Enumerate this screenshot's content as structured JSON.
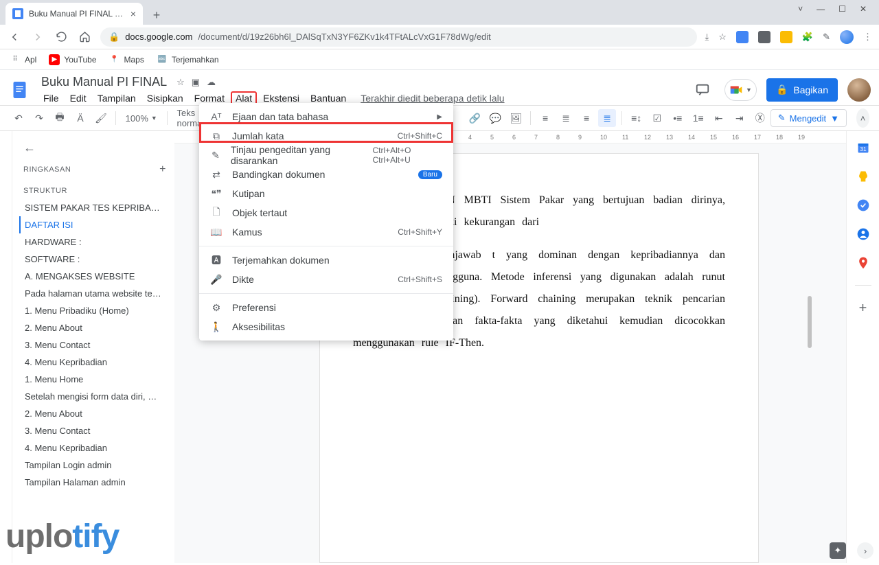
{
  "browser": {
    "tab_title": "Buku Manual PI FINAL - Google",
    "url_host": "docs.google.com",
    "url_path": "/document/d/19z26bh6l_DAlSqTxN3YF6ZKv1k4TFtALcVxG1F78dWg/edit",
    "bookmarks": {
      "apps": "Apl",
      "youtube": "YouTube",
      "maps": "Maps",
      "translate": "Terjemahkan"
    }
  },
  "doc": {
    "title": "Buku Manual PI FINAL",
    "menus": [
      "File",
      "Edit",
      "Tampilan",
      "Sisipkan",
      "Format",
      "Alat",
      "Ekstensi",
      "Bantuan"
    ],
    "history": "Terakhir diedit beberapa detik lalu",
    "share": "Bagikan"
  },
  "toolbar": {
    "zoom": "100%",
    "style": "Teks normal",
    "editing": "Mengedit"
  },
  "outline": {
    "ringkasan": "RINGKASAN",
    "struktur": "STRUKTUR",
    "items": [
      "SISTEM PAKAR TES KEPRIBADIA…",
      "DAFTAR ISI",
      "HARDWARE :",
      "SOFTWARE :",
      "A. MENGAKSES WEBSITE",
      "Pada halaman utama website te…",
      "1. Menu Pribadiku (Home)",
      "2. Menu About",
      "3. Menu Contact",
      "4. Menu Kepribadian",
      "1. Menu Home",
      "Setelah mengisi form data diri, …",
      "2. Menu About",
      "3. Menu Contact",
      "4. Menu Kepribadian",
      "Tampilan Login admin",
      "Tampilan Halaman admin"
    ]
  },
  "dropdown": {
    "items": [
      {
        "icon": "Aᵀ",
        "label": "Ejaan dan tata bahasa",
        "submenu": true
      },
      {
        "icon": "⧉",
        "label": "Jumlah kata",
        "shortcut": "Ctrl+Shift+C"
      },
      {
        "icon": "✎",
        "label": "Tinjau pengeditan yang disarankan",
        "shortcut": "Ctrl+Alt+O Ctrl+Alt+U"
      },
      {
        "icon": "⇄",
        "label": "Bandingkan dokumen",
        "badge": "Baru"
      },
      {
        "icon": "❝❞",
        "label": "Kutipan"
      },
      {
        "icon": "🗋",
        "label": "Objek tertaut"
      },
      {
        "icon": "📖",
        "label": "Kamus",
        "shortcut": "Ctrl+Shift+Y"
      },
      {
        "sep": true
      },
      {
        "icon": "🅰",
        "label": "Terjemahkan dokumen"
      },
      {
        "icon": "🎤",
        "label": "Dikte",
        "shortcut": "Ctrl+Shift+S"
      },
      {
        "sep": true
      },
      {
        "icon": "⚙",
        "label": "Preferensi"
      },
      {
        "icon": "🚶",
        "label": "Aksesibilitas"
      }
    ]
  },
  "page_text": {
    "p1": "RI  BERDASARKAN  MBTI  Sistem  Pakar  yang  bertujuan  badian  dirinya,  supaya  dapat  perbaiki   kekurangan   dari ",
    "p2": "  cara  pengguna  menjawab  t   yang    dominan    dengan   kepribadiannya  dan  nantinya  dipilih  pengguna.  Metode  inferensi  yang  digunakan  adalah  runut  maju  (Forward  chaining).   Forward   chaining  merupakan   teknik   pencarian   yang   dimulai   dengan fakta-fakta   yang   diketahui  kemudian  dicocokkan  menggunakan  rule IF-Then."
  },
  "watermark": {
    "a": "uplo",
    "b": "tify"
  }
}
